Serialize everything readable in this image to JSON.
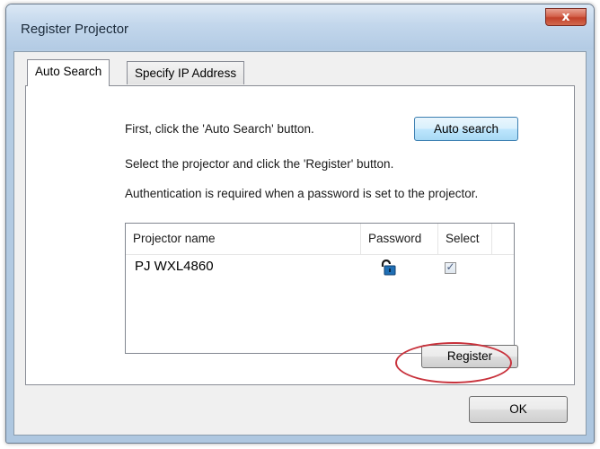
{
  "window": {
    "title": "Register Projector",
    "close_glyph": "x",
    "close_icon": "close-icon"
  },
  "tabs": [
    {
      "label": "Auto Search",
      "active": true
    },
    {
      "label": "Specify IP Address",
      "active": false
    }
  ],
  "auto_search_tab": {
    "instruction_1": "First, click the 'Auto Search' button.",
    "auto_search_button": "Auto search",
    "instruction_2": "Select the projector and click the 'Register' button.",
    "instruction_3": "Authentication is required when a password is set to the projector.",
    "projector_list": {
      "columns": [
        "Projector name",
        "Password",
        "Select"
      ],
      "rows": [
        {
          "projector_name": "PJ WXL4860",
          "password_icon": "lock-icon",
          "selected": true,
          "check_glyph": "✓"
        }
      ]
    },
    "register_button": "Register"
  },
  "footer": {
    "ok_button": "OK"
  },
  "colors": {
    "highlight_ellipse": "#c8323c",
    "close_button": "#c2412a",
    "lock_icon": "#1f6fb5"
  }
}
